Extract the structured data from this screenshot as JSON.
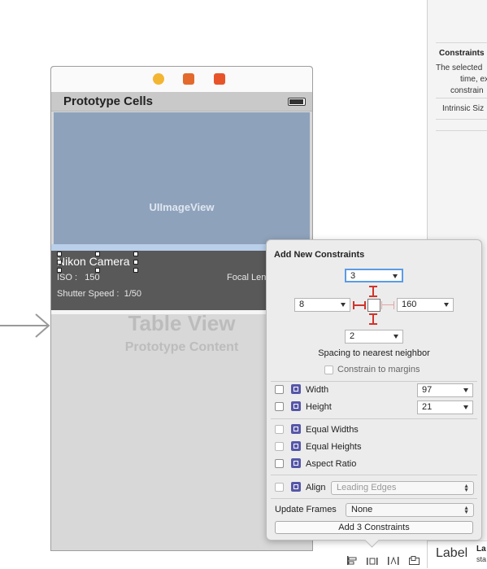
{
  "inspector": {
    "section_title": "Constraints",
    "description_lines": [
      "The selected",
      "time, exp",
      "constrain"
    ],
    "intrinsic_label": "Intrinsic Siz",
    "label_title": "Label",
    "label_small": "La",
    "label_sub": "sta"
  },
  "scene": {
    "nav_title": "Prototype Cells",
    "imageview_label": "UIImageView",
    "camera_name": "Nikon Camera",
    "iso_label": "ISO :",
    "iso_value": "150",
    "focal_label": "Focal Len",
    "shutter_label": "Shutter Speed :",
    "shutter_value": "1/50",
    "table_title": "Table View",
    "table_subtitle": "Prototype Content"
  },
  "popover": {
    "title": "Add New Constraints",
    "top_value": "3",
    "left_value": "8",
    "right_value": "160",
    "bottom_value": "2",
    "spacing_label": "Spacing to nearest neighbor",
    "constrain_margins_label": "Constrain to margins",
    "width_label": "Width",
    "width_value": "97",
    "height_label": "Height",
    "height_value": "21",
    "equal_widths_label": "Equal Widths",
    "equal_heights_label": "Equal Heights",
    "aspect_ratio_label": "Aspect Ratio",
    "align_label": "Align",
    "align_value": "Leading Edges",
    "update_frames_label": "Update Frames",
    "update_frames_value": "None",
    "add_button_label": "Add 3 Constraints"
  },
  "colors": {
    "accent_focus": "#5b9be6",
    "constraint_red": "#d0342c",
    "imageview_fill": "#8ea2bc"
  }
}
